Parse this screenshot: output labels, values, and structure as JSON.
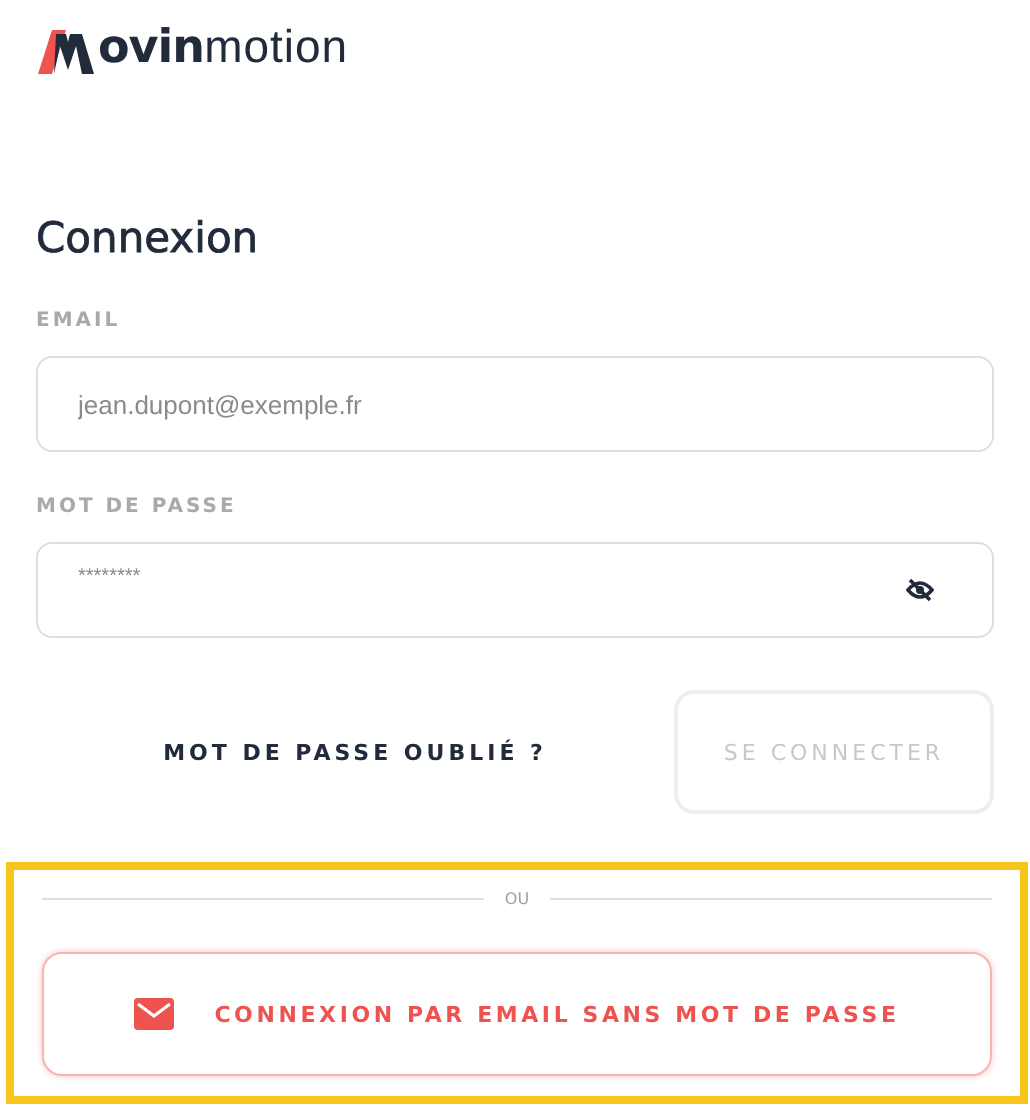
{
  "logo": {
    "bold": "ovin",
    "light": "motion"
  },
  "title": "Connexion",
  "fields": [
    {
      "label": "EMAIL",
      "placeholder": "jean.dupont@exemple.fr",
      "kind": "text"
    },
    {
      "label": "MOT DE PASSE",
      "placeholder": "********",
      "kind": "password",
      "revealed": false
    }
  ],
  "forgot_link": "MOT DE PASSE OUBLIÉ ?",
  "submit": {
    "label": "SE CONNECTER",
    "disabled": true
  },
  "highlighted": true,
  "separator": "OU",
  "magic_link_button": "CONNEXION PAR EMAIL SANS MOT DE PASSE"
}
